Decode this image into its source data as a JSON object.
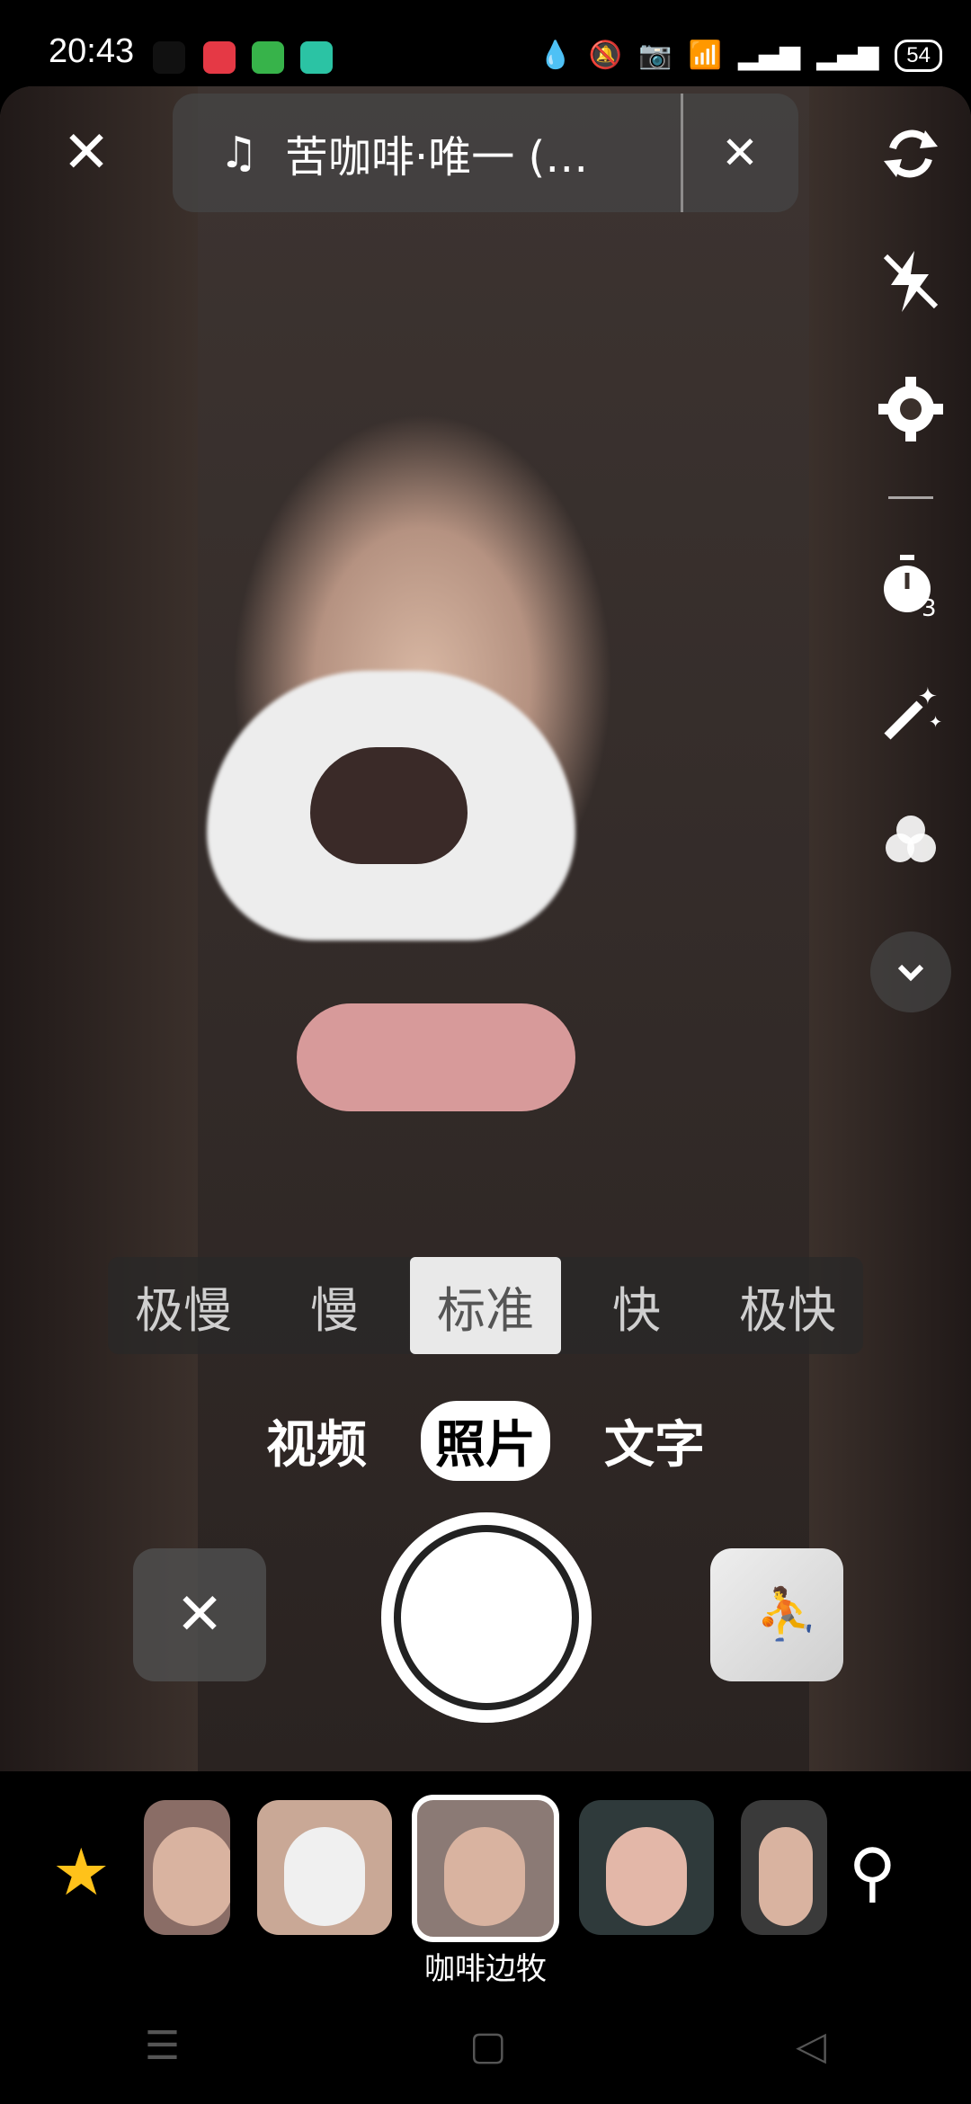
{
  "status": {
    "time": "20:43",
    "battery": "54"
  },
  "music": {
    "title": "苦咖啡·唯一 (…",
    "note_icon": "music-note-icon"
  },
  "side_tools": [
    "flip-camera-icon",
    "flash-off-icon",
    "settings-icon",
    "timer-3-icon",
    "beauty-wand-icon",
    "filter-icon",
    "expand-icon"
  ],
  "speeds": [
    {
      "label": "极慢",
      "active": false
    },
    {
      "label": "慢",
      "active": false
    },
    {
      "label": "标准",
      "active": true
    },
    {
      "label": "快",
      "active": false
    },
    {
      "label": "极快",
      "active": false
    }
  ],
  "modes": [
    {
      "label": "视频",
      "active": false
    },
    {
      "label": "照片",
      "active": true
    },
    {
      "label": "文字",
      "active": false
    }
  ],
  "effects": {
    "selected_label": "咖啡边牧"
  },
  "colors": {
    "accent_star": "#ffc21a"
  }
}
